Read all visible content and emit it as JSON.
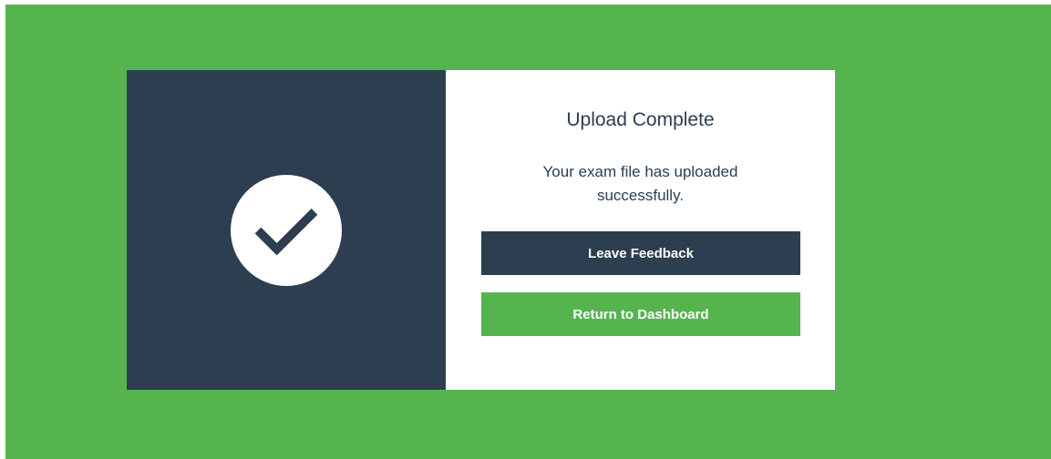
{
  "dialog": {
    "icon": "checkmark-icon",
    "title": "Upload Complete",
    "message": "Your exam file has uploaded successfully.",
    "leave_feedback_label": "Leave Feedback",
    "return_dashboard_label": "Return to Dashboard"
  },
  "colors": {
    "backdrop": "#56b44f",
    "panel_dark": "#2c3e4f",
    "panel_light": "#ffffff",
    "text": "#2c3e4f",
    "primary_button": "#2c3e4f",
    "secondary_button": "#56b44f"
  }
}
